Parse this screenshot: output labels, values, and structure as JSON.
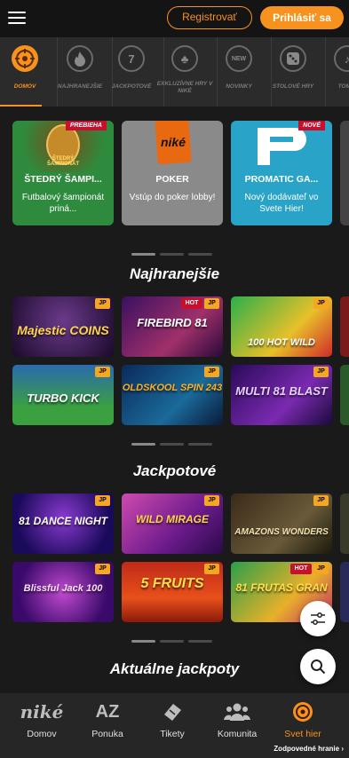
{
  "header": {
    "register_label": "Registrovať",
    "login_label": "Prihlásiť sa"
  },
  "categories": [
    {
      "label": "DOMOV",
      "icon": "roulette-icon"
    },
    {
      "label": "NAJHRANEJŠIE",
      "icon": "fire-icon"
    },
    {
      "label": "JACKPOTOVÉ",
      "icon": "seven-icon"
    },
    {
      "label": "EXKLUZÍVNE HRY V NIKÉ",
      "icon": "clover-icon"
    },
    {
      "label": "NOVINKY",
      "icon": "new-icon"
    },
    {
      "label": "STOLOVÉ HRY",
      "icon": "dice-icon"
    },
    {
      "label": "TOM H",
      "icon": "other-icon"
    }
  ],
  "promos": [
    {
      "title": "ŠTEDRÝ ŠAMPI...",
      "desc": "Futbalový šampionát priná...",
      "badge": "PREBIEHA",
      "art_text": "ŠTEDRÝ ŠAMPIONÁT",
      "color": "#2e8b3d"
    },
    {
      "title": "POKER",
      "desc": "Vstúp do poker lobby!",
      "art_text": "niké",
      "color": "#8a8a8a"
    },
    {
      "title": "PROMATIC GA...",
      "desc": "Nový dodávateľ vo Svete Hier!",
      "badge": "NOVÉ",
      "color": "#2aa3c9"
    }
  ],
  "sections": {
    "najhranejsie": "Najhranejšie",
    "jackpotove": "Jackpotové",
    "aktualne": "Aktuálne jackpoty"
  },
  "games_top": [
    {
      "name": "Majestic COINS",
      "jp": "JP"
    },
    {
      "name": "FIREBIRD 81",
      "jp": "JP",
      "hot": "HOT"
    },
    {
      "name": "100 HOT WILD",
      "jp": "JP"
    },
    {
      "name": "TURBO KICK",
      "jp": "JP"
    },
    {
      "name": "OLDSKOOL SPIN 243",
      "jp": "JP"
    },
    {
      "name": "MULTI 81 BLAST",
      "jp": "JP"
    }
  ],
  "games_jackpot": [
    {
      "name": "81 DANCE NIGHT",
      "jp": "JP"
    },
    {
      "name": "WILD MIRAGE",
      "jp": "JP"
    },
    {
      "name": "AMAZONS WONDERS",
      "jp": "JP"
    },
    {
      "name": "Blissful Jack 100",
      "jp": "JP"
    },
    {
      "name": "5 FRUITS",
      "jp": "JP"
    },
    {
      "name": "81 FRUTAS GRAN",
      "jp": "JP",
      "hot": "HOT"
    }
  ],
  "bottom_nav": [
    {
      "label": "Domov",
      "icon": "nike-logo-icon"
    },
    {
      "label": "Ponuka",
      "icon": "az-icon"
    },
    {
      "label": "Tikety",
      "icon": "ticket-icon"
    },
    {
      "label": "Komunita",
      "icon": "community-icon"
    },
    {
      "label": "Svet hier",
      "icon": "games-world-icon"
    }
  ],
  "responsible_gaming": "Zodpovedné hranie",
  "colors": {
    "accent": "#f7921e",
    "hot": "#c8102e",
    "jp": "#f5a623"
  }
}
